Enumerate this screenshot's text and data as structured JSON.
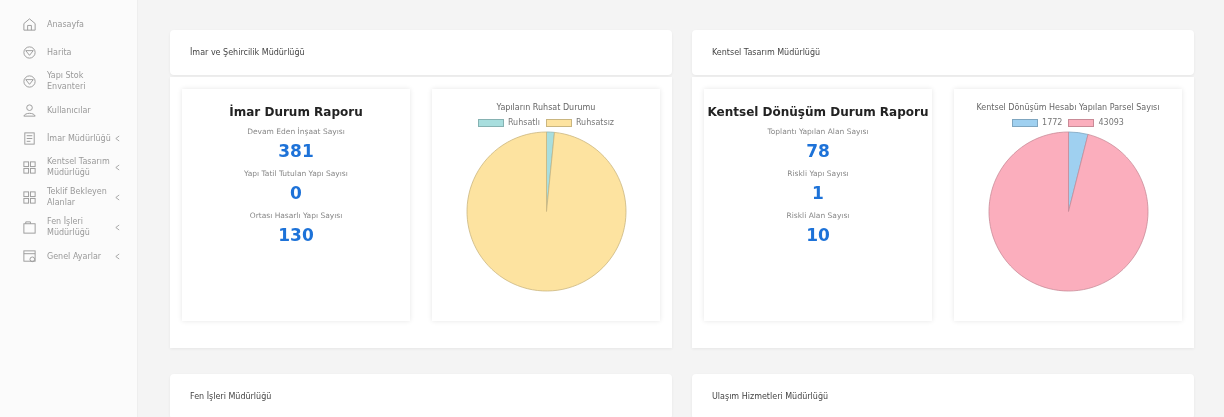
{
  "sidebar": {
    "items": [
      {
        "label": "Anasayfa",
        "kind": "home",
        "expandable": false
      },
      {
        "label": "Harita",
        "kind": "globe",
        "expandable": false
      },
      {
        "label": "Yapı Stok Envanteri",
        "kind": "globe",
        "expandable": false
      },
      {
        "label": "Kullanıcılar",
        "kind": "user",
        "expandable": false
      },
      {
        "label": "İmar Müdürlüğü",
        "kind": "document",
        "expandable": true
      },
      {
        "label": "Kentsel Tasarım Müdürlüğü",
        "kind": "grid",
        "expandable": true
      },
      {
        "label": "Teklif Bekleyen Alanlar",
        "kind": "grid",
        "expandable": true
      },
      {
        "label": "Fen İşleri Müdürlüğü",
        "kind": "folder",
        "expandable": true
      },
      {
        "label": "Genel Ayarlar",
        "kind": "settings",
        "expandable": true
      }
    ]
  },
  "panels": [
    {
      "title": "İmar ve Şehircilik Müdürlüğü",
      "report": {
        "title": "İmar Durum Raporu",
        "stats": [
          {
            "label": "Devam Eden İnşaat Sayısı",
            "value": "381"
          },
          {
            "label": "Yapı Tatil Tutulan Yapı Sayısı",
            "value": "0"
          },
          {
            "label": "Ortası Hasarlı Yapı Sayısı",
            "value": "130"
          }
        ]
      },
      "pie": {
        "title": "Yapıların Ruhsat Durumu",
        "legend": [
          {
            "label": "Ruhsatlı",
            "color": "#a8dede"
          },
          {
            "label": "Ruhsatsız",
            "color": "#fde3a0"
          }
        ]
      }
    },
    {
      "title": "Kentsel Tasarım Müdürlüğü",
      "report": {
        "title": "Kentsel Dönüşüm Durum Raporu",
        "stats": [
          {
            "label": "Toplantı Yapılan Alan Sayısı",
            "value": "78"
          },
          {
            "label": "Riskli Yapı Sayısı",
            "value": "1"
          },
          {
            "label": "Riskli Alan Sayısı",
            "value": "10"
          }
        ]
      },
      "chart_data": {
        "type": "pie",
        "title": "Kentsel Dönüşüm Hesabı Yapılan Parsel Sayısı",
        "categories": [
          "1772",
          "43093"
        ],
        "values": [
          1772,
          43093
        ],
        "colors": [
          "#9fd0f0",
          "#fbaebd"
        ]
      }
    },
    {
      "title": "Fen İşleri Müdürlüğü"
    },
    {
      "title": "Ulaşım Hizmetleri Müdürlüğü"
    }
  ]
}
